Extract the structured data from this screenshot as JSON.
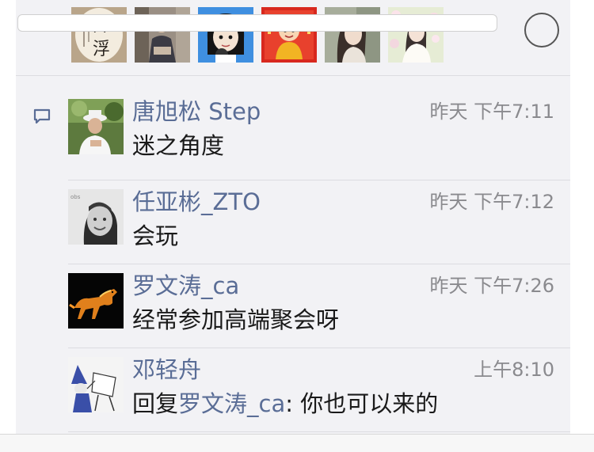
{
  "likes": {
    "avatars": [
      {
        "name": "calligraphy-avatar",
        "chars": "含浮"
      },
      {
        "name": "woman-sitting-avatar"
      },
      {
        "name": "cartoon-girl-avatar"
      },
      {
        "name": "festive-cartoon-avatar"
      },
      {
        "name": "woman-portrait-avatar"
      },
      {
        "name": "woman-flowers-avatar"
      }
    ]
  },
  "comments": [
    {
      "author": "唐旭松 Step",
      "time": "昨天 下午7:11",
      "text": "迷之角度",
      "avatar_icon": "man-with-hat-avatar"
    },
    {
      "author": "任亚彬_ZTO",
      "time": "昨天 下午7:12",
      "text": "会玩",
      "avatar_icon": "man-bw-portrait-avatar"
    },
    {
      "author": "罗文涛_ca",
      "time": "昨天 下午7:26",
      "text": "经常参加高端聚会呀",
      "avatar_icon": "golden-horse-avatar"
    },
    {
      "author": "邓轻舟",
      "time": "上午8:10",
      "reply_prefix": "回复",
      "reply_to": "罗文涛_ca",
      "reply_sep": ": ",
      "text": "你也可以来的",
      "avatar_icon": "wizard-easel-avatar"
    }
  ],
  "colors": {
    "name_link": "#5a6d96",
    "panel_bg": "#f2f2f5",
    "time_gray": "#8a8a8e"
  },
  "icons": {
    "comment_indicator": "comment-bubble-icon",
    "bottom_emoji": "emoji-face-icon"
  }
}
